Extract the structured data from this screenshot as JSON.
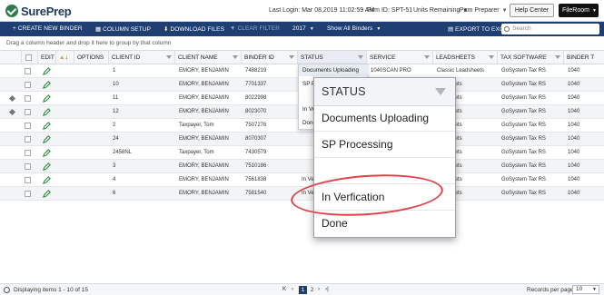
{
  "header": {
    "logo_text": "SurePrep",
    "last_login": "Last Login:  Mar 08,2019 11:02:59 AM",
    "firm_id": "Firm ID:  SPT-51",
    "units_remaining": "Units Remaining",
    "user": "Pam Preparer",
    "help_label": "Help Center",
    "fileroom_label": "FileRoom"
  },
  "toolbar": {
    "create": "+ CREATE NEW BINDER",
    "column_setup": "COLUMN SETUP",
    "download": "DOWNLOAD FILES",
    "clear_filter": "CLEAR FILTER",
    "year": "2017",
    "show": "Show All Binders",
    "export": "EXPORT TO EXCEL",
    "search_placeholder": "Search"
  },
  "group_hint": "Drag a column header and drop it here to group by that column",
  "columns": {
    "edit": "EDIT",
    "options": "OPTIONS",
    "client_id": "CLIENT ID",
    "client_name": "CLIENT NAME",
    "binder_id": "BINDER ID",
    "status": "STATUS",
    "service": "SERVICE",
    "leadsheets": "LEADSHEETS",
    "tax_software": "TAX SOFTWARE",
    "binder_t": "BINDER T"
  },
  "rows": [
    {
      "client_id": "1",
      "client_name": "EMORY, BENJAMIN",
      "binder_id": "7488219",
      "status": "",
      "service": "1040SCAN PRO",
      "leadsheets": "Classic Leadsheets",
      "tax_software": "GoSystem Tax RS",
      "binder_t": "1040"
    },
    {
      "client_id": "10",
      "client_name": "EMORY, BENJAMIN",
      "binder_id": "7701337",
      "status": "",
      "service": "",
      "leadsheets": "eadsheets",
      "tax_software": "GoSystem Tax RS",
      "binder_t": "1040"
    },
    {
      "client_id": "11",
      "client_name": "EMORY, BENJAMIN",
      "binder_id": "8022998",
      "status": "",
      "service": "",
      "leadsheets": "eadsheets",
      "tax_software": "GoSystem Tax RS",
      "binder_t": "1040"
    },
    {
      "client_id": "12",
      "client_name": "EMORY, BENJAMIN",
      "binder_id": "8023070",
      "status": "In Ve",
      "service": "",
      "leadsheets": "eadsheets",
      "tax_software": "GoSystem Tax RS",
      "binder_t": "1040"
    },
    {
      "client_id": "2",
      "client_name": "Taxpayer, Tom",
      "binder_id": "7507276",
      "status": "Done",
      "service": "",
      "leadsheets": "eadsheets",
      "tax_software": "GoSystem Tax RS",
      "binder_t": "1040"
    },
    {
      "client_id": "24",
      "client_name": "EMORY, BENJAMIN",
      "binder_id": "8070307",
      "status": "",
      "service": "",
      "leadsheets": "eadsheets",
      "tax_software": "GoSystem Tax RS",
      "binder_t": "1040"
    },
    {
      "client_id": "2458NL",
      "client_name": "Taxpayer, Tom",
      "binder_id": "7430579",
      "status": "",
      "service": "",
      "leadsheets": "eadsheets",
      "tax_software": "GoSystem Tax RS",
      "binder_t": "1040"
    },
    {
      "client_id": "3",
      "client_name": "EMORY, BENJAMIN",
      "binder_id": "7510186",
      "status": "",
      "service": "",
      "leadsheets": "eadsheets",
      "tax_software": "GoSystem Tax RS",
      "binder_t": "1040"
    },
    {
      "client_id": "4",
      "client_name": "EMORY, BENJAMIN",
      "binder_id": "7561838",
      "status": "In Ve",
      "service": "",
      "leadsheets": "eadsheets",
      "tax_software": "GoSystem Tax RS",
      "binder_t": "1040"
    },
    {
      "client_id": "6",
      "client_name": "EMORY, BENJAMIN",
      "binder_id": "7581540",
      "status": "In Ve",
      "service": "",
      "leadsheets": "eadsheets",
      "tax_software": "GoSystem Tax RS",
      "binder_t": "1040"
    }
  ],
  "mini_dropdown": {
    "options": [
      "Documents Uploading",
      "SP P",
      "",
      "In Ve",
      "Done"
    ]
  },
  "zoom": {
    "title": "STATUS",
    "options": [
      "Documents Uploading",
      "SP Processing",
      "",
      "In Verfication",
      "Done"
    ]
  },
  "footer": {
    "display_text": "Displaying items 1 - 10 of 15",
    "page_first": "K",
    "page_prev": "‹",
    "page_1": "1",
    "page_2": "2",
    "page_next": "›",
    "page_last": "›|",
    "rpp_label": "Records per page:",
    "rpp_value": "10"
  },
  "colors": {
    "toolbar_bg": "#1f3f73",
    "highlight": "#e0414b",
    "pencil": "#2e8a3e"
  }
}
